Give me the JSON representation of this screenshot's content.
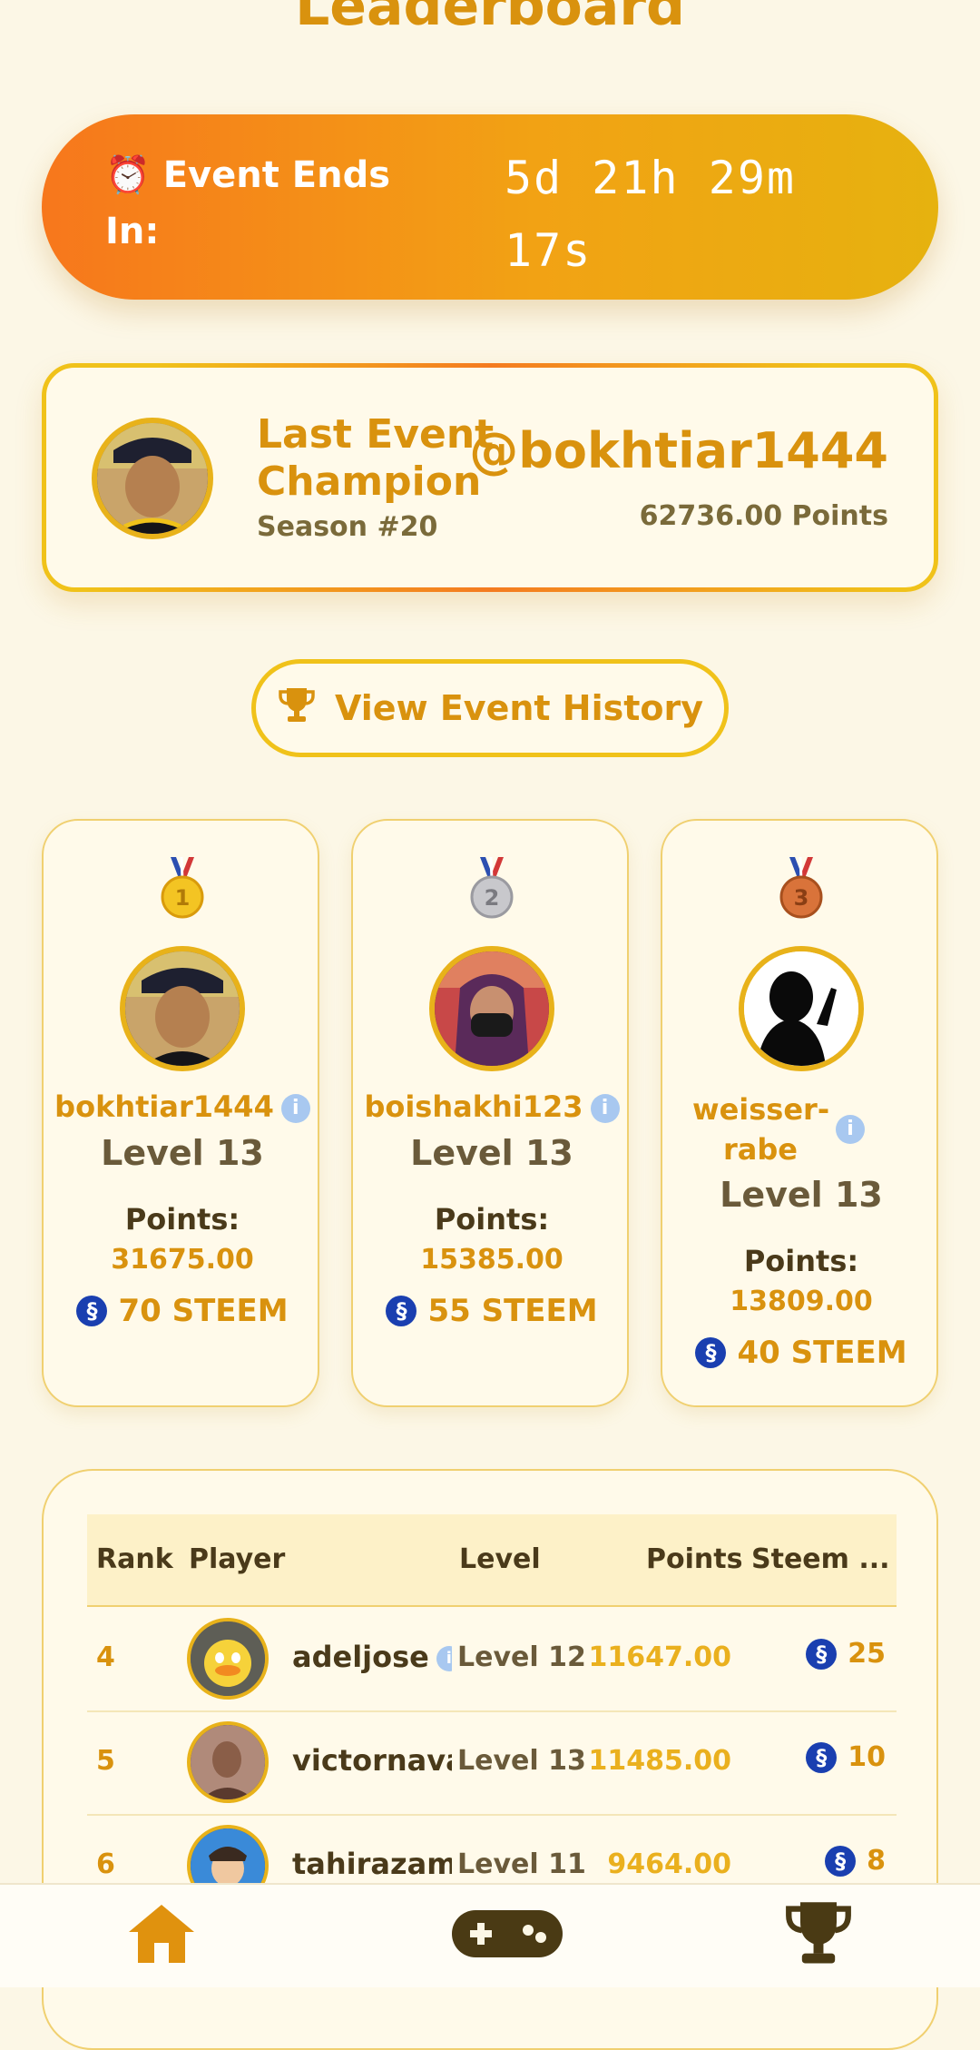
{
  "page": {
    "title": "Leaderboard"
  },
  "timer": {
    "icon": "alarm-clock-icon",
    "label": "⏰ Event Ends In:",
    "value": "5d 21h 29m 17s"
  },
  "champion": {
    "title": "Last Event Champion",
    "season": "Season #20",
    "username": "@bokhtiar1444",
    "points": "62736.00 Points"
  },
  "history_button": {
    "label": "View Event History",
    "icon": "trophy-icon"
  },
  "top3": [
    {
      "medal": "gold-medal-icon",
      "name": "bokhtiar1444",
      "level": "Level 13",
      "points_label": "Points:",
      "points": "31675.00",
      "steem": "70 STEEM"
    },
    {
      "medal": "silver-medal-icon",
      "name": "boishakhi123",
      "level": "Level 13",
      "points_label": "Points:",
      "points": "15385.00",
      "steem": "55 STEEM"
    },
    {
      "medal": "bronze-medal-icon",
      "name": "weisser-rabe",
      "level": "Level 13",
      "points_label": "Points:",
      "points": "13809.00",
      "steem": "40 STEEM"
    }
  ],
  "table": {
    "headers": [
      "Rank",
      "Player",
      "Level",
      "Points",
      "Steem ..."
    ],
    "rows": [
      {
        "rank": "4",
        "player": "adeljose",
        "level": "Level 12",
        "points": "11647.00",
        "steem": "25"
      },
      {
        "rank": "5",
        "player": "victornava",
        "level": "Level 13",
        "points": "11485.00",
        "steem": "10"
      },
      {
        "rank": "6",
        "player": "tahirazam",
        "level": "Level 11",
        "points": "9464.00",
        "steem": "8"
      }
    ]
  },
  "nav": {
    "items": [
      "home-icon",
      "gamepad-icon",
      "trophy-icon"
    ]
  },
  "colors": {
    "accent": "#d9920e",
    "gradient_start": "#f7771c",
    "gradient_end": "#e6b20f",
    "background": "#fcf7e6",
    "steem_blue": "#1a3fb0"
  }
}
